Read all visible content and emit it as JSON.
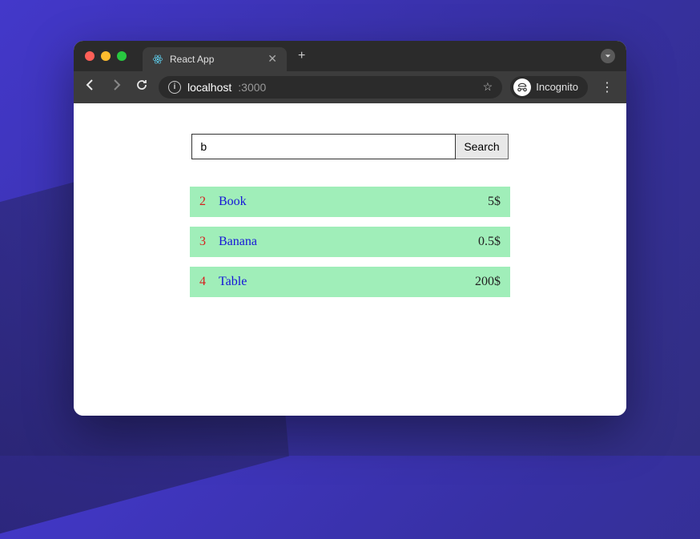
{
  "browser": {
    "tab_title": "React App",
    "url_host": "localhost",
    "url_port": ":3000",
    "incognito_label": "Incognito"
  },
  "search": {
    "value": "b",
    "button_label": "Search"
  },
  "results": [
    {
      "index": "2",
      "name": "Book",
      "price": "5$"
    },
    {
      "index": "3",
      "name": "Banana",
      "price": "0.5$"
    },
    {
      "index": "4",
      "name": "Table",
      "price": "200$"
    }
  ]
}
